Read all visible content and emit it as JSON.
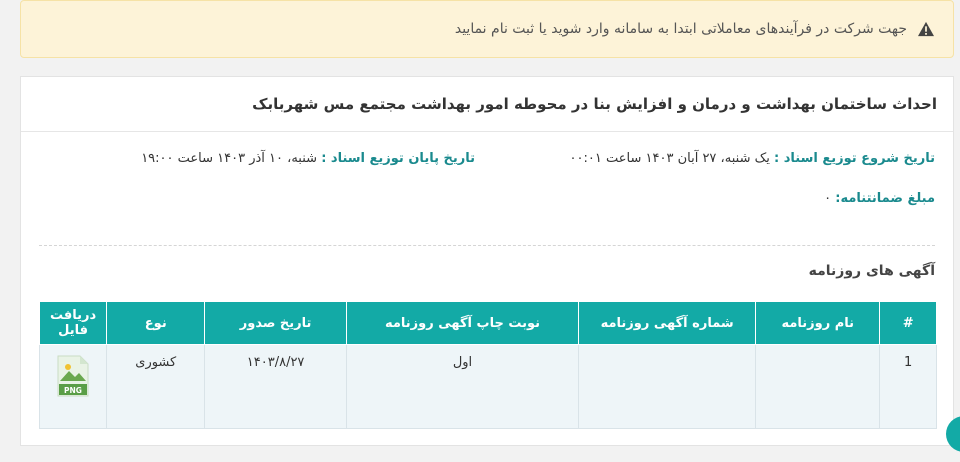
{
  "alert": {
    "icon": "warning-icon",
    "text": "جهت شرکت در فرآیندهای معاملاتی ابتدا به سامانه وارد شوید یا ثبت نام نمایید"
  },
  "tender": {
    "title": "احداث ساختمان بهداشت و درمان و افزایش بنا در محوطه امور بهداشت مجتمع مس شهربابک",
    "start_label": "تاریخ شروع توزیع اسناد :",
    "start_value": "یک شنبه، ۲۷ آبان ۱۴۰۳ ساعت ۰۰:۰۱",
    "end_label": "تاریخ پایان توزیع اسناد :",
    "end_value": "شنبه، ۱۰ آذر ۱۴۰۳ ساعت ۱۹:۰۰",
    "guarantee_label": "مبلغ ضمانتنامه:",
    "guarantee_value": "۰"
  },
  "ads": {
    "section_title": "آگهی های روزنامه",
    "headers": [
      "#",
      "نام روزنامه",
      "شماره آگهی روزنامه",
      "نوبت چاپ آگهی روزنامه",
      "تاریخ صدور",
      "نوع",
      "دریافت فایل"
    ],
    "rows": [
      {
        "index": "1",
        "newspaper": "",
        "ad_number": "",
        "print_turn": "اول",
        "issue_date": "۱۴۰۳/۸/۲۷",
        "type": "کشوری",
        "file_icon": "png-file-icon",
        "file_label": "PNG"
      }
    ]
  },
  "colors": {
    "accent": "#13aaa6",
    "label": "#1a8a8e",
    "alert_bg": "#fdf3d8"
  }
}
